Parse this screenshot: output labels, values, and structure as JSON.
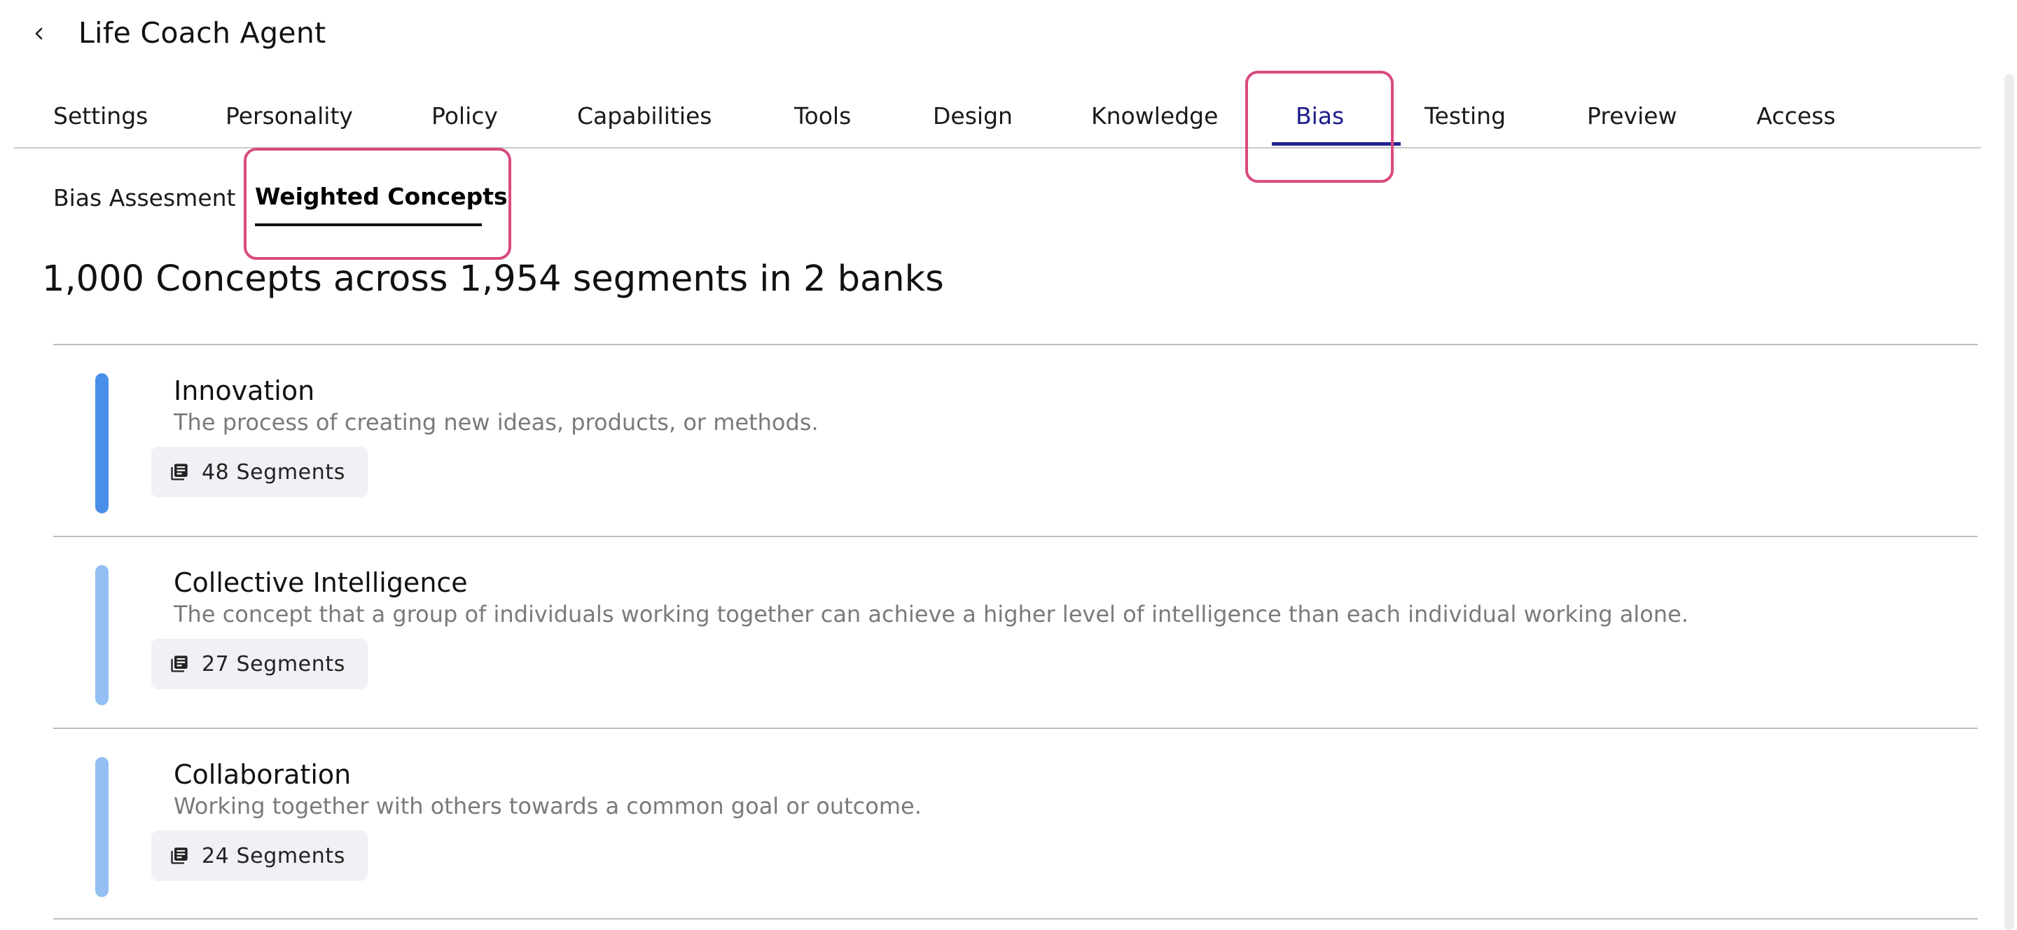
{
  "header": {
    "title": "Life Coach Agent"
  },
  "tabs": [
    {
      "label": "Settings"
    },
    {
      "label": "Personality"
    },
    {
      "label": "Policy"
    },
    {
      "label": "Capabilities"
    },
    {
      "label": "Tools"
    },
    {
      "label": "Design"
    },
    {
      "label": "Knowledge"
    },
    {
      "label": "Bias",
      "active": true
    },
    {
      "label": "Testing"
    },
    {
      "label": "Preview"
    },
    {
      "label": "Access"
    }
  ],
  "subtabs": [
    {
      "label": "Bias Assesment"
    },
    {
      "label": "Weighted Concepts",
      "active": true
    }
  ],
  "summary": "1,000 Concepts across 1,954 segments in 2 banks",
  "concepts": [
    {
      "name": "Innovation",
      "description": "The process of creating new ideas, products, or methods.",
      "segments": "48 Segments",
      "weight_color": "#4a8fe7"
    },
    {
      "name": "Collective Intelligence",
      "description": "The concept that a group of individuals working together can achieve a higher level of intelligence than each individual working alone.",
      "segments": "27 Segments",
      "weight_color": "#93bff2"
    },
    {
      "name": "Collaboration",
      "description": "Working together with others towards a common goal or outcome.",
      "segments": "24 Segments",
      "weight_color": "#93bff2"
    }
  ],
  "colors": {
    "accent": "#22228f",
    "highlight": "#d94a80"
  }
}
